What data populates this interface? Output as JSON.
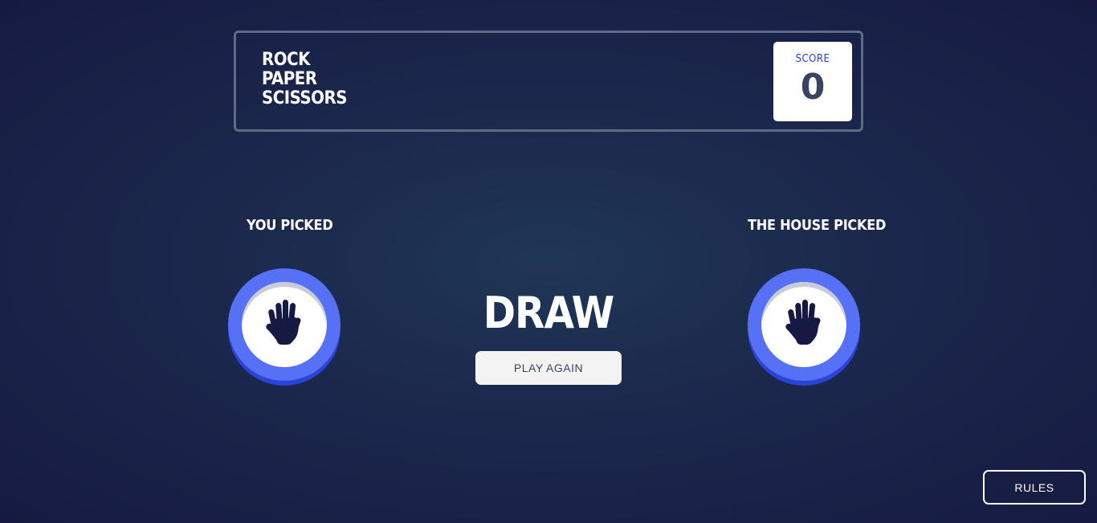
{
  "header": {
    "title_lines": [
      "ROCK",
      "PAPER",
      "SCISSORS"
    ],
    "score_label": "SCORE",
    "score_value": "0"
  },
  "game": {
    "you_label": "YOU PICKED",
    "house_label": "THE HOUSE PICKED",
    "you_pick_icon": "paper-hand-icon",
    "house_pick_icon": "paper-hand-icon",
    "result_text": "DRAW",
    "play_again_label": "PLAY AGAIN"
  },
  "footer": {
    "rules_label": "RULES"
  },
  "colors": {
    "paper_ring": "#5671f5",
    "paper_ring_shadow": "#2b44d8",
    "score_label": "#2a45c2",
    "dark_text": "#3b4363",
    "header_border": "#5e6b83"
  }
}
